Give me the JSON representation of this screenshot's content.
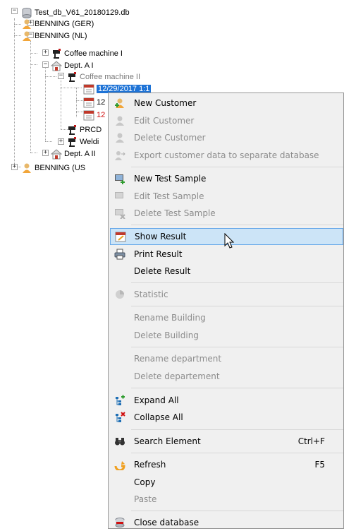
{
  "tree": {
    "root": "Test_db_V61_20180129.db",
    "customer_ger": "BENNING (GER)",
    "customer_nl": "BENNING (NL)",
    "coffee_machine_1": "Coffee machine I",
    "dept_a1": "Dept. A I",
    "coffee_machine_2": "Coffee machine II",
    "result_1": "12/29/2017 1:1",
    "result_2": "12",
    "result_3": "12",
    "prcd": "PRCD",
    "welding": "Weldi",
    "dept_a2": "Dept. A II",
    "customer_us": "BENNING (US"
  },
  "menu": {
    "new_customer": "New Customer",
    "edit_customer": "Edit Customer",
    "delete_customer": "Delete Customer",
    "export_customer": "Export customer data to separate database",
    "new_test_sample": "New Test Sample",
    "edit_test_sample": "Edit Test Sample",
    "delete_test_sample": "Delete Test Sample",
    "show_result": "Show Result",
    "print_result": "Print Result",
    "delete_result": "Delete Result",
    "statistic": "Statistic",
    "rename_building": "Rename Building",
    "delete_building": "Delete Building",
    "rename_department": "Rename department",
    "delete_department": "Delete departement",
    "expand_all": "Expand All",
    "collapse_all": "Collapse All",
    "search_element": "Search Element",
    "search_shortcut": "Ctrl+F",
    "refresh": "Refresh",
    "refresh_shortcut": "F5",
    "copy": "Copy",
    "paste": "Paste",
    "close_database": "Close database"
  },
  "colors": {
    "selection": "#1e73d6",
    "highlight": "#cce4f7",
    "menu_bg": "#f0f0f0",
    "result_red": "#d01010"
  }
}
